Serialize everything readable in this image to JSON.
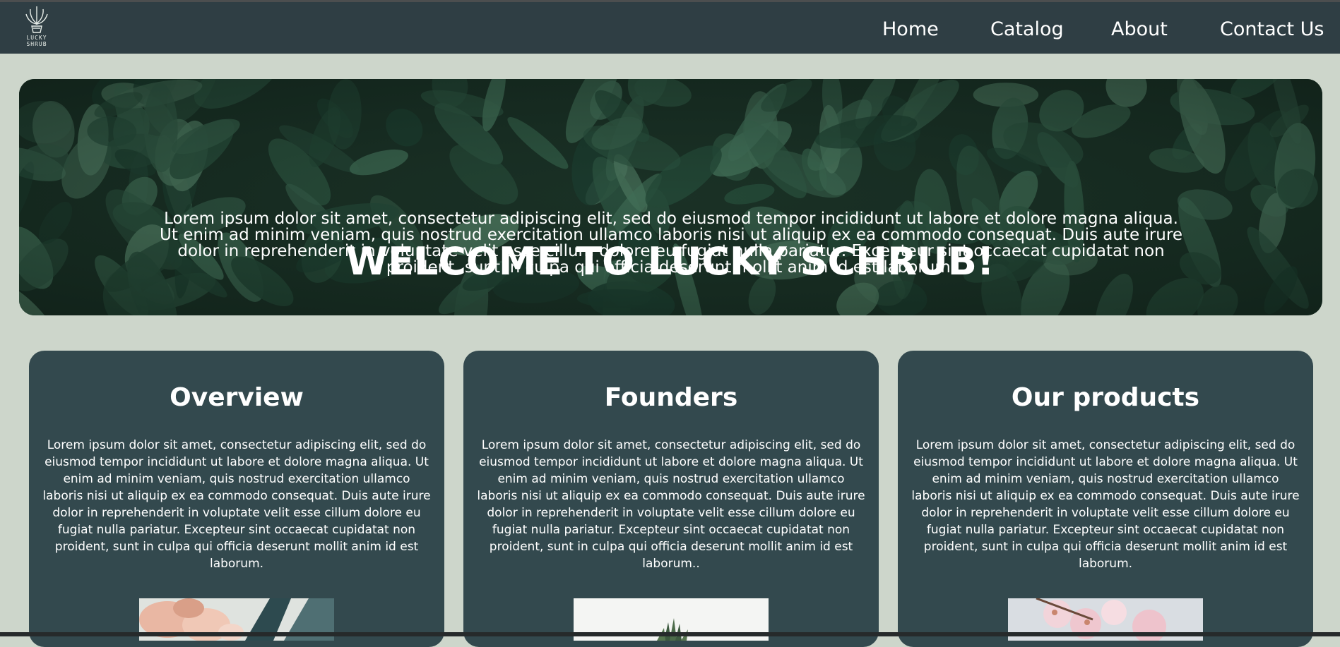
{
  "brand": {
    "logo_text": "LUCKY SHRUB"
  },
  "nav": {
    "items": [
      "Home",
      "Catalog",
      "About",
      "Contact Us"
    ]
  },
  "hero": {
    "title": "WELCOME TO LUCKY SCHRUB!",
    "text": "Lorem ipsum dolor sit amet, consectetur adipiscing elit, sed do eiusmod tempor incididunt ut labore et dolore magna aliqua. Ut enim ad minim veniam, quis nostrud exercitation ullamco laboris nisi ut aliquip ex ea commodo consequat. Duis aute irure dolor in reprehenderit in voluptate velit esse cillum dolore eu fugiat nulla pariatur. Excepteur sint occaecat cupidatat non proident, sunt in culpa qui officia deserunt mollit anim id est laborum."
  },
  "cards": [
    {
      "title": "Overview",
      "text": "Lorem ipsum dolor sit amet, consectetur adipiscing elit, sed do eiusmod tempor incididunt ut labore et dolore magna aliqua. Ut enim ad minim veniam, quis nostrud exercitation ullamco laboris nisi ut aliquip ex ea commodo consequat. Duis aute irure dolor in reprehenderit in voluptate velit esse cillum dolore eu fugiat nulla pariatur. Excepteur sint occaecat cupidatat non proident, sunt in culpa qui officia deserunt mollit anim id est laborum."
    },
    {
      "title": "Founders",
      "text": "Lorem ipsum dolor sit amet, consectetur adipiscing elit, sed do eiusmod tempor incididunt ut labore et dolore magna aliqua. Ut enim ad minim veniam, quis nostrud exercitation ullamco laboris nisi ut aliquip ex ea commodo consequat. Duis aute irure dolor in reprehenderit in voluptate velit esse cillum dolore eu fugiat nulla pariatur. Excepteur sint occaecat cupidatat non proident, sunt in culpa qui officia deserunt mollit anim id est laborum.."
    },
    {
      "title": "Our products",
      "text": "Lorem ipsum dolor sit amet, consectetur adipiscing elit, sed do eiusmod tempor incididunt ut labore et dolore magna aliqua. Ut enim ad minim veniam, quis nostrud exercitation ullamco laboris nisi ut aliquip ex ea commodo consequat. Duis aute irure dolor in reprehenderit in voluptate velit esse cillum dolore eu fugiat nulla pariatur. Excepteur sint occaecat cupidatat non proident, sunt in culpa qui officia deserunt mollit anim id est laborum."
    }
  ],
  "colors": {
    "page_background": "#cdd6cb",
    "navbar": "#2f3e44",
    "card": "#33494e",
    "hero_foliage": "#1d3529",
    "text": "#ffffff"
  }
}
